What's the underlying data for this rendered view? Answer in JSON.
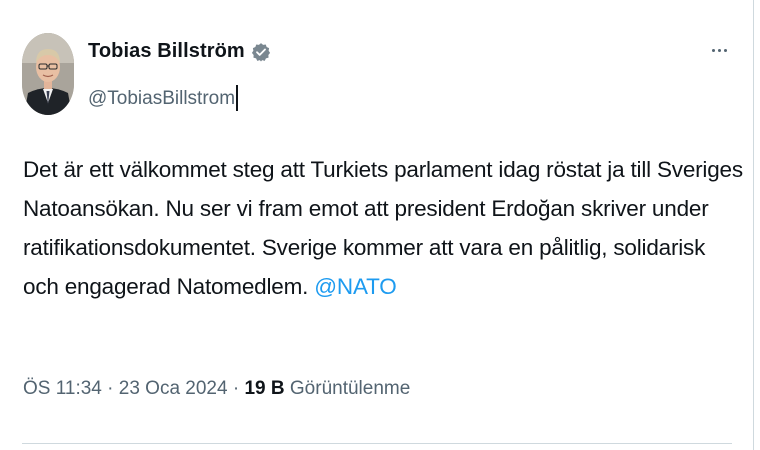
{
  "author": {
    "display_name": "Tobias Billström",
    "handle": "@TobiasBillstrom",
    "verified": true
  },
  "icons": {
    "verified": "verified-badge-icon",
    "more": "more-horizontal-icon"
  },
  "tweet": {
    "lines": [
      "Det är ett välkommet steg att Turkiets parlament idag röstat ja till Sveriges",
      "Natoansökan. Nu ser vi fram emot att president Erdoğan skriver under",
      "ratifikationsdokumentet. Sverige kommer att vara en pålitlig, solidarisk",
      "och engagerad Natomedlem."
    ],
    "mention": "@NATO"
  },
  "meta": {
    "time": "ÖS 11:34",
    "separator": "·",
    "date": "23 Oca 2024",
    "views_count": "19 B",
    "views_label": "Görüntülenme"
  },
  "colors": {
    "link": "#1d9bf0",
    "secondary_text": "#536471",
    "primary_text": "#0f1419",
    "border": "#cfd9de"
  }
}
